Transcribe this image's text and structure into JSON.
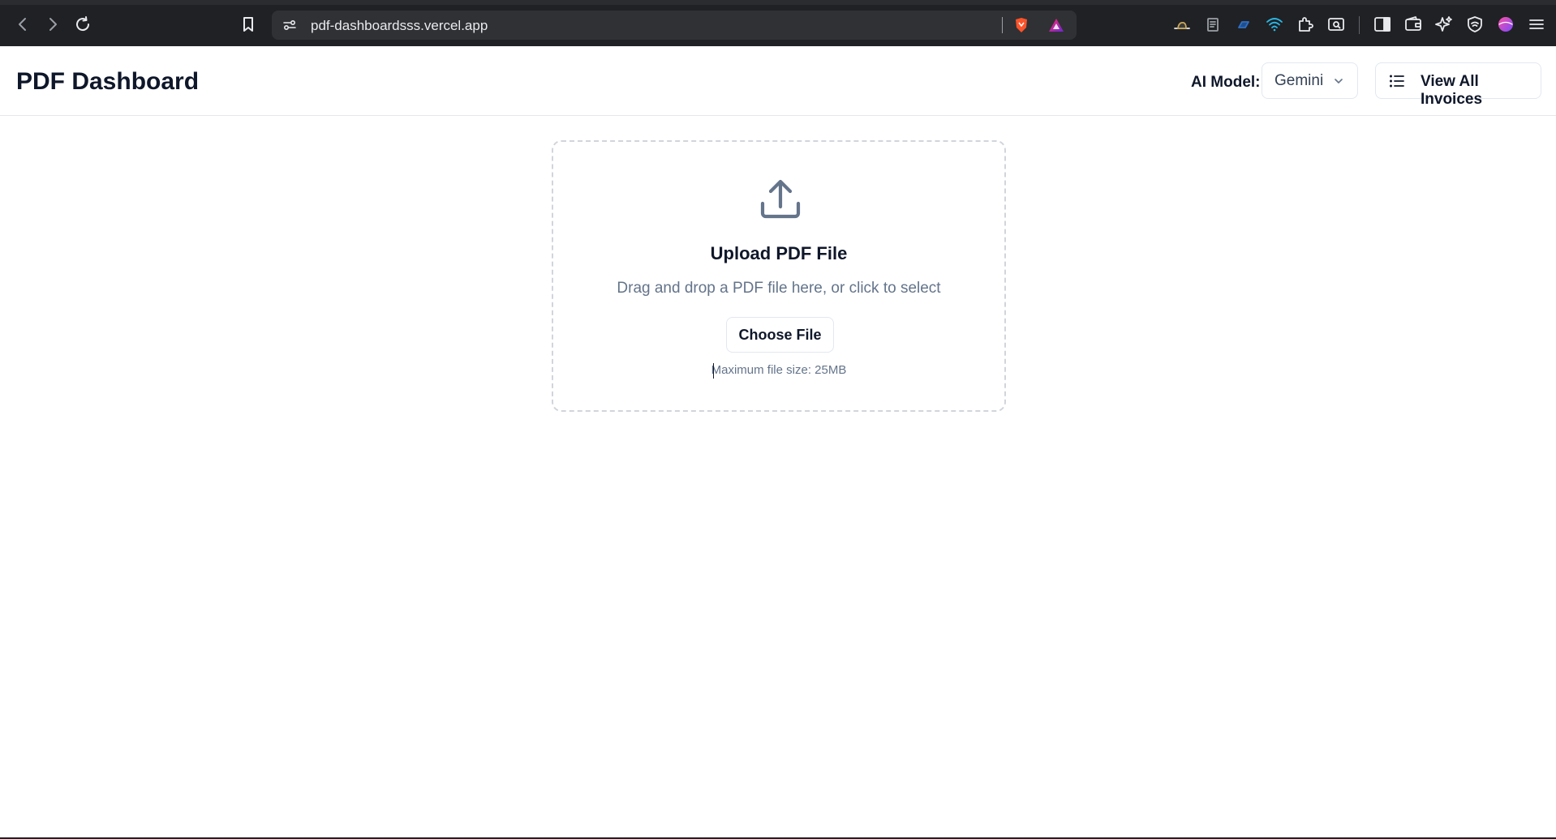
{
  "browser": {
    "url": "pdf-dashboardsss.vercel.app",
    "icons": [
      "back-icon",
      "forward-icon",
      "reload-icon",
      "bookmark-icon",
      "site-settings-icon",
      "brave-shields-icon",
      "brave-rewards-icon",
      "sidebar-icon",
      "wallet-icon",
      "leo-ai-icon",
      "vpn-icon",
      "profile-icon",
      "menu-icon"
    ]
  },
  "header": {
    "title": "PDF Dashboard",
    "model_label": "AI Model:",
    "model_value": "Gemini",
    "invoices_button": "View All Invoices"
  },
  "upload": {
    "title": "Upload PDF File",
    "description": "Drag and drop a PDF file here, or click to select",
    "choose_button": "Choose File",
    "max_size": "Maximum file size: 25MB"
  },
  "colors": {
    "browser_bg": "#202124",
    "address_bg": "#303134",
    "text_primary": "#0f172a",
    "text_muted": "#64748b",
    "border": "#e2e8f0",
    "dashed_border": "#d1d5db",
    "icon_slate": "#64748b",
    "brave_orange": "#fb542b"
  }
}
